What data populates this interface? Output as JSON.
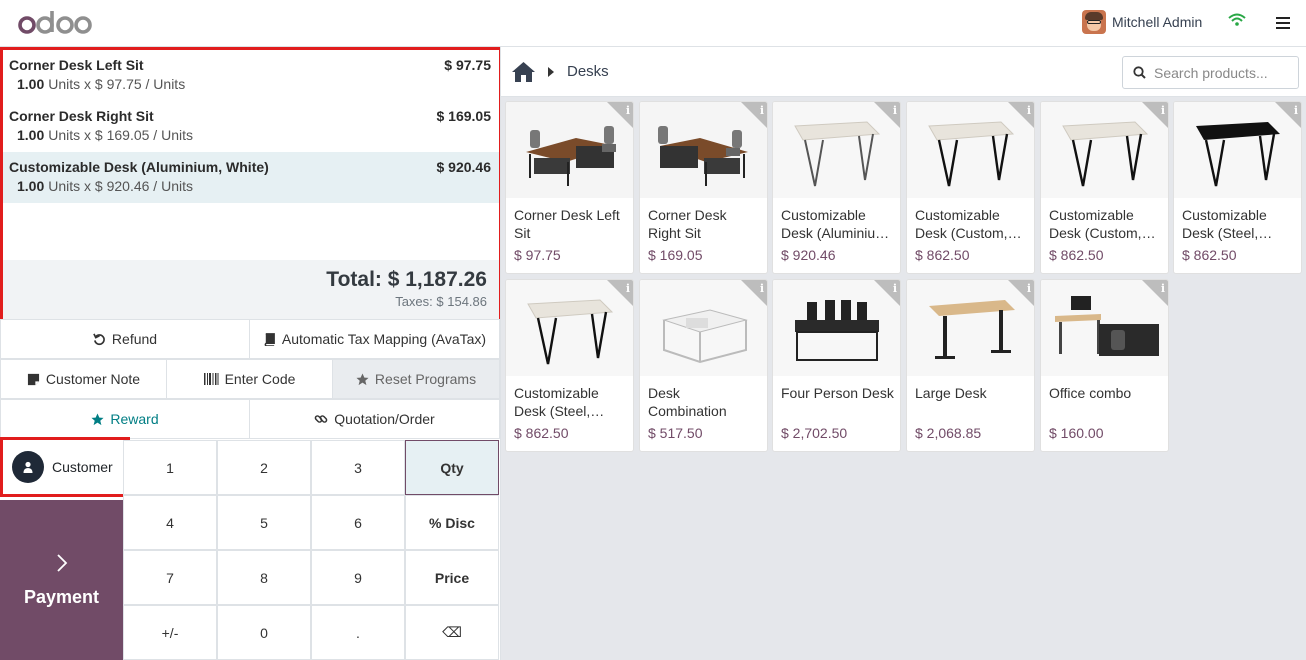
{
  "header": {
    "logo_text": "odoo",
    "user_name": "Mitchell Admin"
  },
  "order": {
    "lines": [
      {
        "name": "Corner Desk Left Sit",
        "price": "$ 97.75",
        "qty": "1.00",
        "detail": "Units x $ 97.75 / Units"
      },
      {
        "name": "Corner Desk Right Sit",
        "price": "$ 169.05",
        "qty": "1.00",
        "detail": "Units x $ 169.05 / Units"
      },
      {
        "name": "Customizable Desk (Aluminium, White)",
        "price": "$ 920.46",
        "qty": "1.00",
        "detail": "Units x $ 920.46 / Units"
      }
    ],
    "total": "Total: $ 1,187.26",
    "taxes": "Taxes: $ 154.86"
  },
  "controls": {
    "refund": "Refund",
    "tax_mapping": "Automatic Tax Mapping (AvaTax)",
    "customer_note": "Customer Note",
    "enter_code": "Enter Code",
    "reset_programs": "Reset Programs",
    "reward": "Reward",
    "quotation": "Quotation/Order",
    "customer": "Customer",
    "payment": "Payment"
  },
  "numpad": {
    "keys": [
      "1",
      "2",
      "3",
      "Qty",
      "4",
      "5",
      "6",
      "% Disc",
      "7",
      "8",
      "9",
      "Price",
      "+/-",
      "0",
      ".",
      "⌫"
    ],
    "active_mode": "Qty"
  },
  "products_bar": {
    "breadcrumb": "Desks",
    "search_placeholder": "Search products..."
  },
  "products": [
    {
      "name": "Corner Desk Left Sit",
      "price": "$ 97.75",
      "info": "i"
    },
    {
      "name": "Corner Desk Right Sit",
      "price": "$ 169.05",
      "info": "i"
    },
    {
      "name": "Customizable Desk (Aluminiu…",
      "price": "$ 920.46",
      "info": "i"
    },
    {
      "name": "Customizable Desk (Custom,…",
      "price": "$ 862.50",
      "info": "i"
    },
    {
      "name": "Customizable Desk (Custom,…",
      "price": "$ 862.50",
      "info": "i"
    },
    {
      "name": "Customizable Desk (Steel,…",
      "price": "$ 862.50",
      "info": "i"
    },
    {
      "name": "Customizable Desk (Steel,…",
      "price": "$ 862.50",
      "info": "i"
    },
    {
      "name": "Desk Combination",
      "price": "$ 517.50",
      "info": "i"
    },
    {
      "name": "Four Person Desk",
      "price": "$ 2,702.50",
      "info": "i"
    },
    {
      "name": "Large Desk",
      "price": "$ 2,068.85",
      "info": "i"
    },
    {
      "name": "Office combo",
      "price": "$ 160.00",
      "info": "i"
    }
  ],
  "colors": {
    "brand": "#714b67",
    "accent_teal": "#017e84",
    "highlight_red": "#e11d1d",
    "price": "#714b67"
  }
}
